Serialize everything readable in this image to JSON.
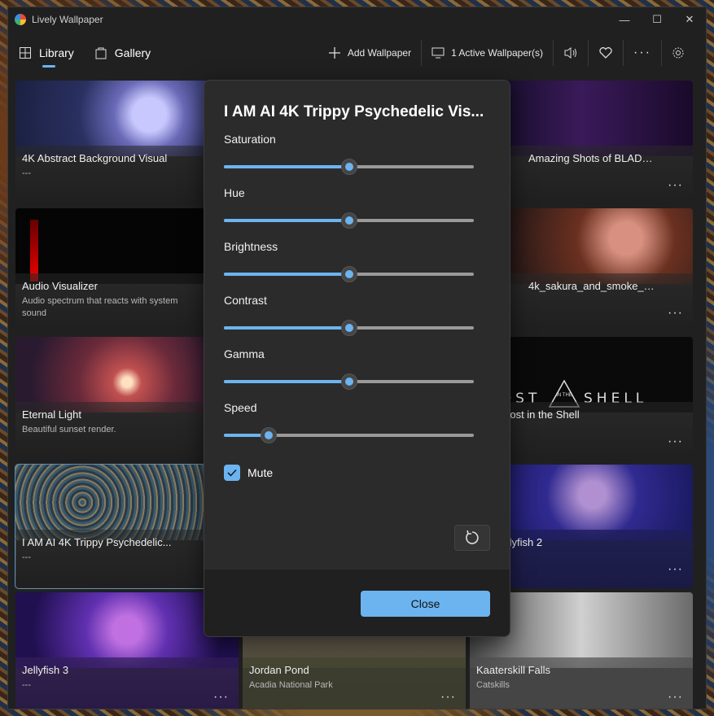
{
  "window": {
    "title": "Lively Wallpaper",
    "minimize": "—",
    "maximize": "☐",
    "close": "✕"
  },
  "nav": {
    "library": "Library",
    "gallery": "Gallery"
  },
  "toolbar": {
    "add_wallpaper": "Add Wallpaper",
    "active": "1 Active Wallpaper(s)",
    "more": "···"
  },
  "cards": [
    {
      "title": "4K Abstract Background Visual",
      "subtitle": "---"
    },
    {
      "title": "Amazing Shots of BLADE RUNNER...",
      "subtitle": ""
    },
    {
      "title": "Audio Visualizer",
      "subtitle": "Audio spectrum that reacts with system sound"
    },
    {
      "title": "4k_sakura_and_smoke_with_filt...",
      "subtitle": ""
    },
    {
      "title": "Eternal Light",
      "subtitle": "Beautiful sunset render."
    },
    {
      "title": "Ghost in the Shell",
      "subtitle": ""
    },
    {
      "title": "I AM AI   4K Trippy Psychedelic...",
      "subtitle": "---"
    },
    {
      "title": "Jellyfish 2",
      "subtitle": ""
    },
    {
      "title": "Jellyfish 3",
      "subtitle": "---"
    },
    {
      "title": "Jordan Pond",
      "subtitle": "Acadia National Park"
    },
    {
      "title": "Kaaterskill Falls",
      "subtitle": "Catskills"
    }
  ],
  "card_more": "···",
  "ghost_logo": {
    "left": "HOST",
    "center": "IN THE",
    "right": "SHELL"
  },
  "dialog": {
    "title": "I AM AI   4K Trippy Psychedelic Vis...",
    "sliders": [
      {
        "label": "Saturation",
        "value": 0.5
      },
      {
        "label": "Hue",
        "value": 0.5
      },
      {
        "label": "Brightness",
        "value": 0.5
      },
      {
        "label": "Contrast",
        "value": 0.5
      },
      {
        "label": "Gamma",
        "value": 0.5
      },
      {
        "label": "Speed",
        "value": 0.18
      }
    ],
    "mute_label": "Mute",
    "mute_checked": true,
    "close_label": "Close"
  }
}
